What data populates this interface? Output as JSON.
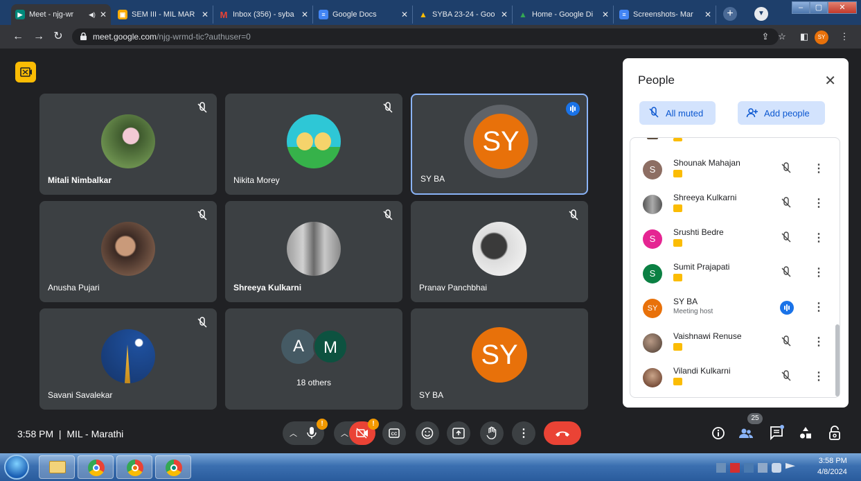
{
  "browser": {
    "tabs": [
      {
        "label": "Meet - njg-wr",
        "active": true
      },
      {
        "label": "SEM III - MIL MAR",
        "active": false
      },
      {
        "label": "Inbox (356) - syba",
        "active": false
      },
      {
        "label": "Google Docs",
        "active": false
      },
      {
        "label": "SYBA 23-24 - Goo",
        "active": false
      },
      {
        "label": "Home - Google Di",
        "active": false
      },
      {
        "label": "Screenshots- Mar",
        "active": false
      }
    ],
    "url_domain": "meet.google.com",
    "url_path": "/njg-wrmd-tic?authuser=0",
    "profile_initials": "SY"
  },
  "tiles": [
    {
      "name": "Mitali Nimbalkar",
      "muted": true,
      "bold": true
    },
    {
      "name": "Nikita Morey",
      "muted": true,
      "bold": false
    },
    {
      "name": "SY BA",
      "initials": "SY",
      "speaking": true,
      "bold": false
    },
    {
      "name": "Anusha Pujari",
      "muted": true,
      "bold": false
    },
    {
      "name": "Shreeya Kulkarni",
      "muted": true,
      "bold": true
    },
    {
      "name": "Pranav Panchbhai",
      "muted": true,
      "bold": false
    },
    {
      "name": "Savani Savalekar",
      "muted": true,
      "bold": false
    },
    {
      "others_initials": [
        "A",
        "M"
      ],
      "others_label": "18 others"
    },
    {
      "name": "SY BA",
      "initials": "SY"
    }
  ],
  "people_panel": {
    "title": "People",
    "all_muted_label": "All muted",
    "add_people_label": "Add people",
    "participants": [
      {
        "name": "Shounak Mahajan",
        "initial": "S",
        "avatar_color": "#8d6e63",
        "muted": true
      },
      {
        "name": "Shreeya Kulkarni",
        "initial": "",
        "avatar_color": "#6d6d6d",
        "muted": true
      },
      {
        "name": "Srushti Bedre",
        "initial": "S",
        "avatar_color": "#e52592",
        "muted": true
      },
      {
        "name": "Sumit Prajapati",
        "initial": "S",
        "avatar_color": "#0b8043",
        "muted": true
      },
      {
        "name": "SY BA",
        "initial": "SY",
        "avatar_color": "#e8710a",
        "subtitle": "Meeting host",
        "speaking": true
      },
      {
        "name": "Vaishnawi Renuse",
        "initial": "",
        "avatar_color": "#6b4f3f",
        "muted": true
      },
      {
        "name": "Vilandi Kulkarni",
        "initial": "",
        "avatar_color": "#7b3f2a",
        "muted": true
      }
    ]
  },
  "bottom_bar": {
    "time": "3:58 PM",
    "meeting_name": "MIL - Marathi",
    "participant_count": "25",
    "alert_badge": "!"
  },
  "taskbar": {
    "time": "3:58 PM",
    "date": "4/8/2024"
  }
}
